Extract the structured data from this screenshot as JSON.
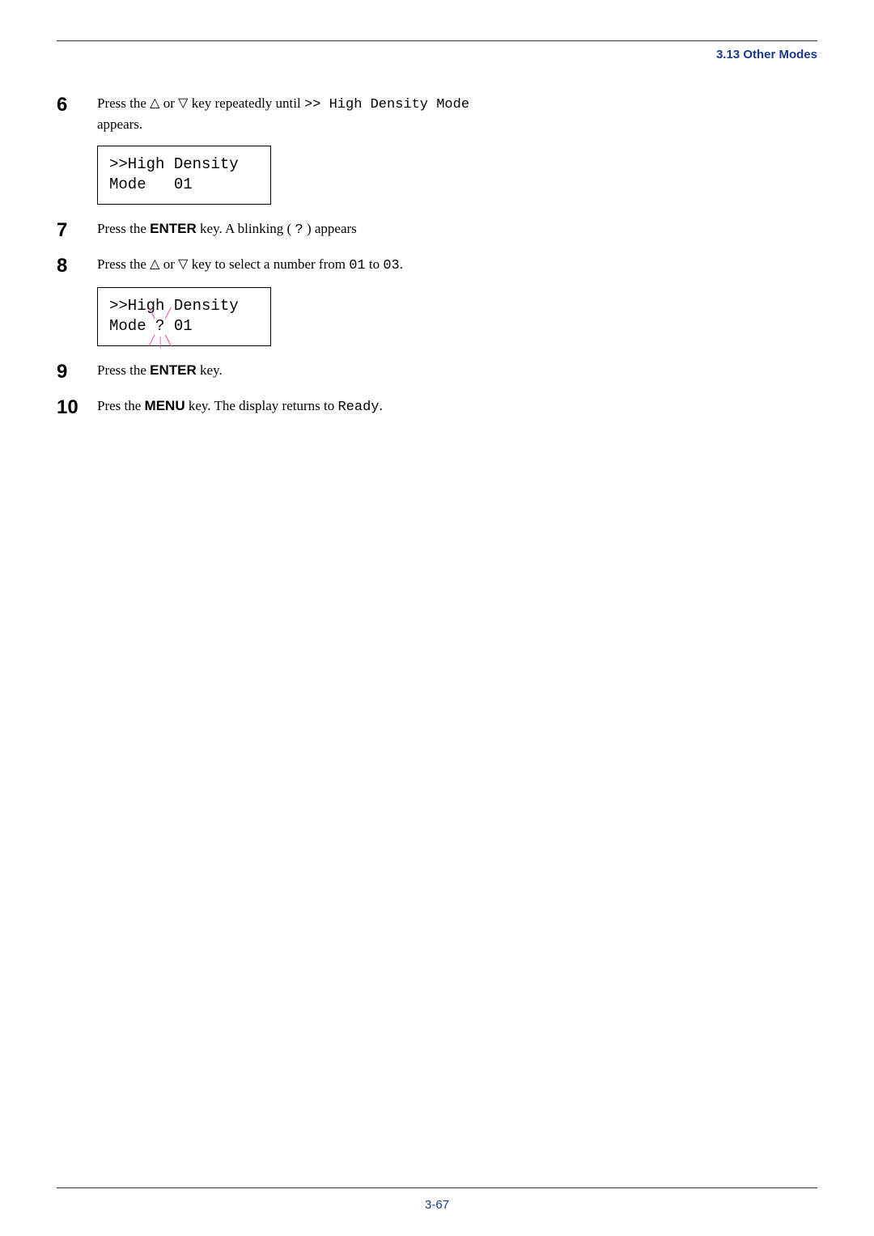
{
  "header": {
    "section": "3.13 Other Modes"
  },
  "steps": {
    "s6": {
      "num": "6",
      "t1": "Press the ",
      "t2": " or ",
      "t3": " key repeatedly until ",
      "code1": ">>  High Density Mode",
      "t4": " appears.",
      "box_l1": ">>High Density",
      "box_l2": "Mode   01"
    },
    "s7": {
      "num": "7",
      "t1": "Press the ",
      "key": "ENTER",
      "t2": " key. A blinking ( ",
      "code1": "?",
      "t3": " ) appears"
    },
    "s8": {
      "num": "8",
      "t1": "Press the ",
      "t2": " or ",
      "t3": " key to select a number from ",
      "code1": "01",
      "t4": " to ",
      "code2": "03",
      "t5": ".",
      "box_l1": ">>High Density",
      "box_l2a": "Mode ",
      "box_q": "?",
      "box_l2b": " 01"
    },
    "s9": {
      "num": "9",
      "t1": "Press the ",
      "key": "ENTER",
      "t2": " key."
    },
    "s10": {
      "num": "10",
      "t1": "Pres the ",
      "key": "MENU",
      "t2": " key. The display returns to ",
      "code1": "Ready",
      "t3": "."
    }
  },
  "footer": {
    "pagenum": "3-67"
  },
  "glyphs": {
    "tri_up": "△",
    "tri_dn": "▽"
  }
}
